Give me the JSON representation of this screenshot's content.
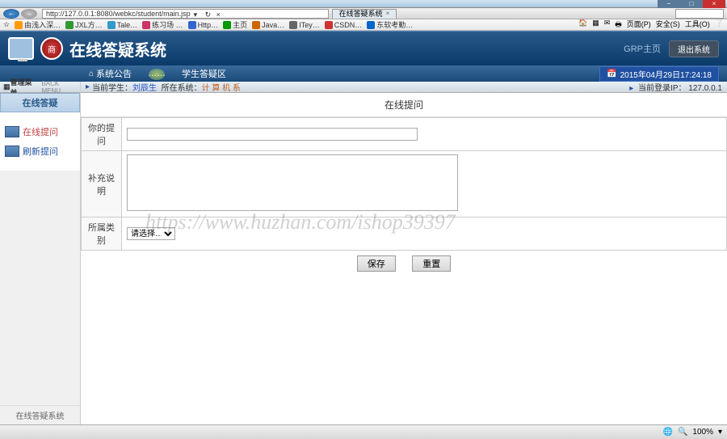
{
  "browser": {
    "url": "http://127.0.0.1:8080/webkc/student/main.jsp",
    "tab_title": "在线答疑系统",
    "bookmarks": [
      "由浅入深…",
      "JXL方…",
      "Tale…",
      "练习场 …",
      "Http…",
      "主页",
      "Java…",
      "ITey…",
      "CSDN…",
      "东软考勤…"
    ],
    "menu_page": "页面(P)",
    "menu_safety": "安全(S)",
    "menu_tools": "工具(O)"
  },
  "app": {
    "title": "在线答疑系统",
    "seal": "商",
    "header_link": "GRP主页",
    "exit": "退出系统",
    "menu": {
      "item1": "系统公告",
      "item2": "……",
      "item3": "学生答疑区"
    },
    "datetime": "2015年04月29日17:24:18"
  },
  "sidebar": {
    "top_label": "管理菜单",
    "top_sub": "BACK MENU",
    "header": "在线答疑",
    "items": [
      {
        "label": "在线提问",
        "active": true
      },
      {
        "label": "刷新提问",
        "active": false
      }
    ],
    "footer": "在线答疑系统"
  },
  "info": {
    "student_label": "当前学生：",
    "student_value": "刘辰生",
    "dept_label": "所在系统：",
    "dept_value": "计 算 机 系",
    "ip_label": "当前登录IP：",
    "ip_value": "127.0.0.1"
  },
  "form": {
    "title": "在线提问",
    "question_label": "你的提问",
    "desc_label": "补充说明",
    "category_label": "所属类别",
    "category_placeholder": "请选择…",
    "save": "保存",
    "reset": "重置"
  },
  "status": {
    "zoom": "100%"
  },
  "watermark": "https://www.huzhan.com/ishop39397"
}
